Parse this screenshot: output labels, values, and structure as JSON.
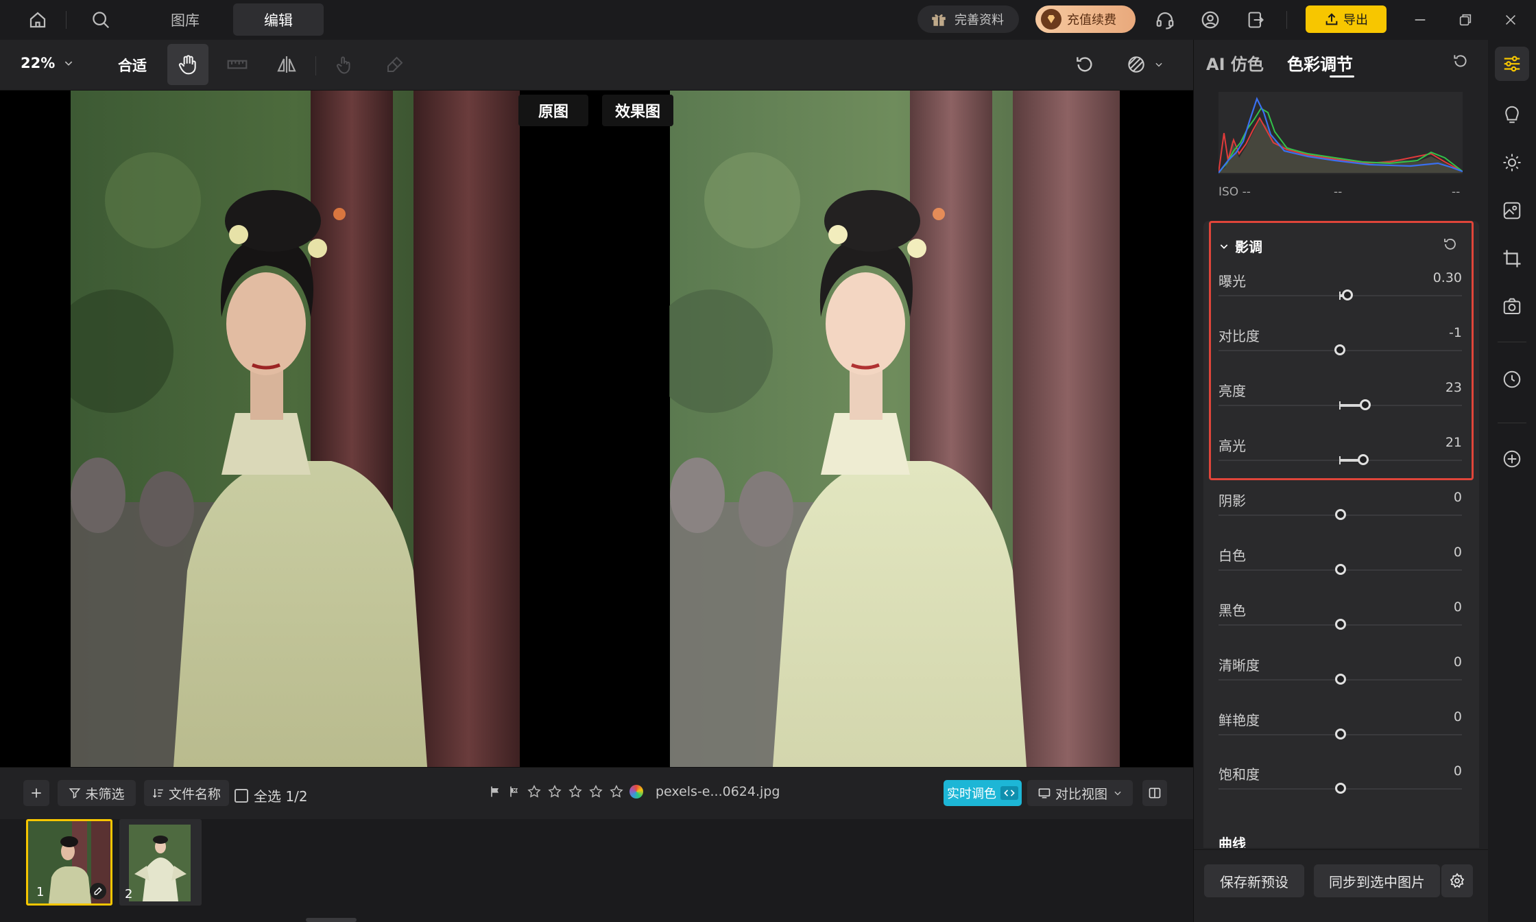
{
  "topbar": {
    "tabs": [
      "图库",
      "编辑"
    ],
    "profile_label": "完善资料",
    "recharge_label": "充值续费",
    "export_label": "导出",
    "accent_yellow": "#f7c600"
  },
  "toolbar": {
    "zoom": "22%",
    "fit_label": "合适"
  },
  "viewer": {
    "original_label": "原图",
    "effect_label": "效果图"
  },
  "bottombar": {
    "filter_label": "未筛选",
    "sort_label": "文件名称",
    "select_all_label": "全选 1/2",
    "filename": "pexels-e...0624.jpg",
    "realtime_label": "实时调色",
    "compare_view_label": "对比视图",
    "realtime_color": "#1db6d6"
  },
  "filmstrip": {
    "items": [
      {
        "number": "1"
      },
      {
        "number": "2"
      }
    ]
  },
  "panel": {
    "tabs": [
      "AI 仿色",
      "色彩调节"
    ],
    "histogram": {
      "iso_label": "ISO --",
      "mid_label": "--",
      "right_label": "--"
    },
    "section_title": "影调",
    "highlight_color": "#e0453a",
    "sliders": [
      {
        "label": "曝光",
        "value": "0.30"
      },
      {
        "label": "对比度",
        "value": "-1"
      },
      {
        "label": "亮度",
        "value": "23"
      },
      {
        "label": "高光",
        "value": "21"
      },
      {
        "label": "阴影",
        "value": "0"
      },
      {
        "label": "白色",
        "value": "0"
      },
      {
        "label": "黑色",
        "value": "0"
      },
      {
        "label": "清晰度",
        "value": "0"
      },
      {
        "label": "鲜艳度",
        "value": "0"
      },
      {
        "label": "饱和度",
        "value": "0"
      }
    ],
    "next_section": "曲线",
    "save_preset_label": "保存新预设",
    "sync_label": "同步到选中图片"
  }
}
